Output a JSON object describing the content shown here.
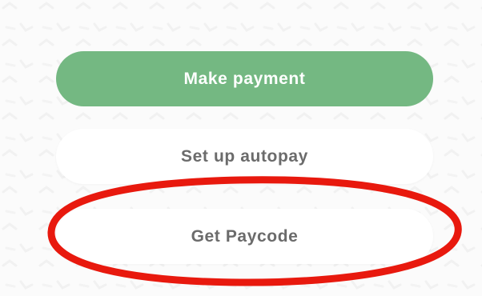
{
  "buttons": {
    "make_payment": "Make payment",
    "setup_autopay": "Set up autopay",
    "get_paycode": "Get Paycode"
  },
  "colors": {
    "primary_button": "#74b882",
    "secondary_text": "#6b6b6b",
    "highlight_ring": "#e8190e",
    "background": "#fbfbfb"
  }
}
